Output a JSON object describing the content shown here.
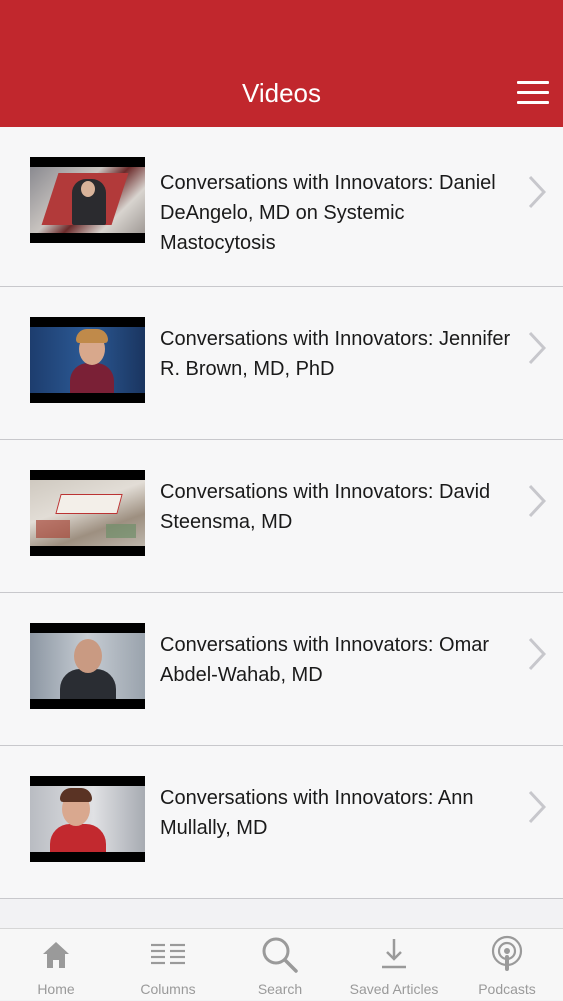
{
  "header": {
    "title": "Videos"
  },
  "videos": [
    {
      "title": "Conversations with Innovators: Daniel DeAngelo, MD on Systemic Mastocytosis"
    },
    {
      "title": "Conversations with Innovators: Jennifer R. Brown, MD, PhD"
    },
    {
      "title": "Conversations with Innovators: David Steensma, MD"
    },
    {
      "title": "Conversations with Innovators: Omar Abdel-Wahab, MD"
    },
    {
      "title": "Conversations with Innovators: Ann Mullally, MD"
    }
  ],
  "tabs": [
    {
      "label": "Home",
      "icon": "home-icon"
    },
    {
      "label": "Columns",
      "icon": "columns-icon"
    },
    {
      "label": "Search",
      "icon": "search-icon"
    },
    {
      "label": "Saved Articles",
      "icon": "download-icon"
    },
    {
      "label": "Podcasts",
      "icon": "podcast-icon"
    }
  ],
  "colors": {
    "header": "#c1272d",
    "tab_inactive": "#9a9a9a"
  }
}
